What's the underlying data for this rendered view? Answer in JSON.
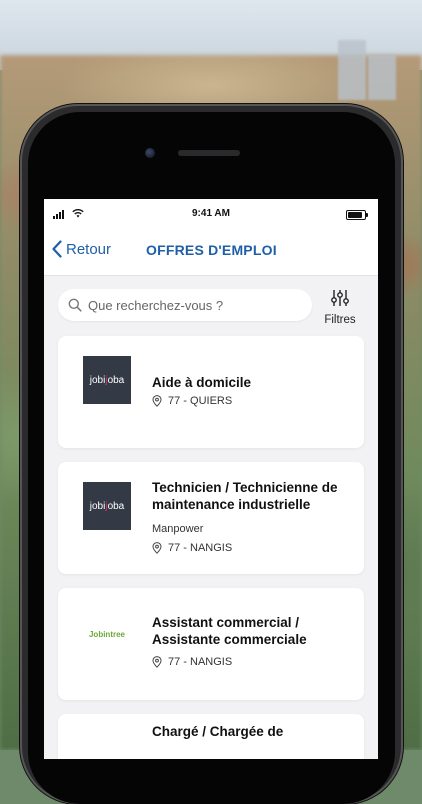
{
  "status": {
    "time": "9:41 AM"
  },
  "nav": {
    "back_label": "Retour",
    "title": "OFFRES D'EMPLOI"
  },
  "search": {
    "placeholder": "Que recherchez-vous ?",
    "filters_label": "Filtres"
  },
  "jobs": [
    {
      "logo_brand": "jobijoba",
      "title": "Aide à domicile",
      "company": "",
      "location": "77 - QUIERS"
    },
    {
      "logo_brand": "jobijoba",
      "title": "Technicien / Technicienne de maintenance industrielle",
      "company": "Manpower",
      "location": "77 - NANGIS"
    },
    {
      "logo_brand": "Jobintree",
      "title": "Assistant commercial / Assistante commerciale",
      "company": "",
      "location": "77 - NANGIS"
    },
    {
      "logo_brand": "",
      "title": "Chargé / Chargée de",
      "company": "",
      "location": ""
    }
  ],
  "logos": {
    "jobijoba_pre": "jobi",
    "jobijoba_mid": "j",
    "jobijoba_post": "oba",
    "jobintree": "Jobintree"
  },
  "colors": {
    "accent": "#1f5fa8",
    "jobijoba_bg": "#333a46",
    "jobijoba_dot": "#d9326a",
    "jobintree_green": "#6aa939"
  }
}
